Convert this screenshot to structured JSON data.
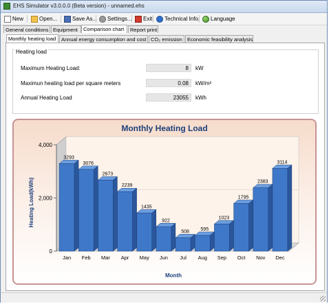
{
  "window": {
    "title": "EHS Simulator v3.0.0.0 (Beta version) - unnamed.ehs"
  },
  "toolbar": [
    {
      "label": "New",
      "icon": "new-file-icon"
    },
    {
      "label": "Open...",
      "icon": "open-folder-icon"
    },
    {
      "label": "Save As...",
      "icon": "save-icon"
    },
    {
      "label": "Settings...",
      "icon": "settings-gear-icon"
    },
    {
      "label": "Exit",
      "icon": "exit-icon"
    },
    {
      "label": "Technical Info.",
      "icon": "info-icon"
    },
    {
      "label": "Language",
      "icon": "globe-icon"
    }
  ],
  "tabs": [
    "General conditions",
    "Equipment",
    "Comparison chart",
    "Report print"
  ],
  "active_tab": "Comparison chart",
  "subtabs": [
    "Monthly heating load",
    "Annual energy consumption and cost",
    "CO₂  emission",
    "Economic feasibility analysis"
  ],
  "active_subtab": "Monthly heating load",
  "heating_load": {
    "group_title": "Heating load",
    "rows": [
      {
        "label": "Maximum Heating Load:",
        "value": "8",
        "unit": "kW"
      },
      {
        "label": "Maximun heating load per square meters",
        "value": "0.08",
        "unit": "kW/m²"
      },
      {
        "label": "Annual Heating Load",
        "value": "23055",
        "unit": "kWh"
      }
    ]
  },
  "colors": {
    "bar_front": "#3f78c8",
    "bar_top": "#6a9ee0",
    "bar_side": "#2a569b",
    "chart_title": "#1d3f7a",
    "accent_border": "#c79393"
  },
  "chart_data": {
    "type": "bar",
    "title": "Monthly Heating Load",
    "xlabel": "Month",
    "ylabel": "Heating Load(kWh)",
    "categories": [
      "Jan",
      "Feb",
      "Mar",
      "Apr",
      "May",
      "Jun",
      "Jul",
      "Aug",
      "Sep",
      "Oct",
      "Nov",
      "Dec"
    ],
    "values": [
      3293,
      3076,
      2673,
      2239,
      1435,
      922,
      508,
      595,
      1023,
      1795,
      2383,
      3114
    ],
    "data_labels": [
      "3293",
      "3076",
      "2673",
      "2239",
      "1435",
      "922",
      "508",
      "595",
      "1023",
      "1795",
      "2383",
      "3114"
    ],
    "ylim": [
      0,
      4000
    ],
    "yticks": [
      0,
      2000,
      4000
    ],
    "ytick_labels": [
      "0",
      "2,000",
      "4,000"
    ],
    "grid": true,
    "style": "3d"
  }
}
